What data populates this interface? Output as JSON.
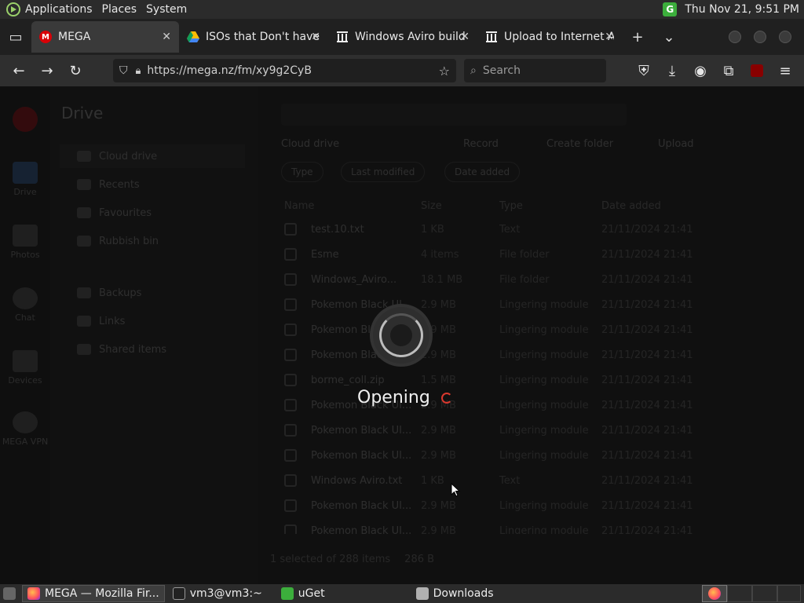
{
  "top_panel": {
    "menus": [
      "Applications",
      "Places",
      "System"
    ],
    "clock": "Thu Nov 21,  9:51 PM"
  },
  "tabs": [
    {
      "title": "MEGA",
      "favicon": "mega-icon",
      "active": true
    },
    {
      "title": "ISOs that Don't haven",
      "favicon": "drive-icon",
      "active": false
    },
    {
      "title": "Windows Aviro build",
      "favicon": "archive-icon",
      "active": false
    },
    {
      "title": "Upload to Internet Arc",
      "favicon": "archive-icon",
      "active": false
    }
  ],
  "navbar": {
    "url": "https://mega.nz/fm/xy9g2CyB",
    "search_placeholder": "Search"
  },
  "mega": {
    "sidebar_title": "Drive",
    "leftnav": [
      "Drive",
      "Photos",
      "Chat",
      "Devices",
      "MEGA VPN"
    ],
    "sidebar_items": [
      "Cloud drive",
      "Recents",
      "Favourites",
      "Rubbish bin"
    ],
    "sidebar_items2": [
      "Backups",
      "Links",
      "Shared items"
    ],
    "breadcrumb": "Cloud drive",
    "toolbar": [
      "Record",
      "Create folder",
      "Upload"
    ],
    "filters": [
      "Type",
      "Last modified",
      "Date added"
    ],
    "columns": [
      "Name",
      "Size",
      "Type",
      "Date added"
    ],
    "files": [
      {
        "name": "test.10.txt",
        "size": "1 KB",
        "type": "Text",
        "date": "21/11/2024 21:41"
      },
      {
        "name": "Esme",
        "size": "4 items",
        "type": "File folder",
        "date": "21/11/2024 21:41"
      },
      {
        "name": "Windows_Aviro...",
        "size": "18.1 MB",
        "type": "File folder",
        "date": "21/11/2024 21:41"
      },
      {
        "name": "Pokemon Black Ul...",
        "size": "2.9 MB",
        "type": "Lingering module",
        "date": "21/11/2024 21:41"
      },
      {
        "name": "Pokemon Black Ul...",
        "size": "2.9 MB",
        "type": "Lingering module",
        "date": "21/11/2024 21:41"
      },
      {
        "name": "Pokemon Black Ul...",
        "size": "2.9 MB",
        "type": "Lingering module",
        "date": "21/11/2024 21:41"
      },
      {
        "name": "borme_coll.zip",
        "size": "1.5 MB",
        "type": "Lingering module",
        "date": "21/11/2024 21:41"
      },
      {
        "name": "Pokemon Black Ul...",
        "size": "2.9 MB",
        "type": "Lingering module",
        "date": "21/11/2024 21:41"
      },
      {
        "name": "Pokemon Black Ul...",
        "size": "2.9 MB",
        "type": "Lingering module",
        "date": "21/11/2024 21:41"
      },
      {
        "name": "Pokemon Black Ul...",
        "size": "2.9 MB",
        "type": "Lingering module",
        "date": "21/11/2024 21:41"
      },
      {
        "name": "Windows Aviro.txt",
        "size": "1 KB",
        "type": "Text",
        "date": "21/11/2024 21:41"
      },
      {
        "name": "Pokemon Black Ul...",
        "size": "2.9 MB",
        "type": "Lingering module",
        "date": "21/11/2024 21:41"
      },
      {
        "name": "Pokemon Black Ul...",
        "size": "2.9 MB",
        "type": "Lingering module",
        "date": "21/11/2024 21:41"
      }
    ],
    "status": "1 selected of 288 items",
    "status_size": "286 B"
  },
  "overlay": {
    "opening_text": "Opening"
  },
  "taskbar": [
    {
      "label": "MEGA — Mozilla Fir...",
      "icon": "firefox-icon",
      "active": true
    },
    {
      "label": "vm3@vm3:~",
      "icon": "terminal-icon",
      "active": false
    },
    {
      "label": "uGet",
      "icon": "uget-icon",
      "active": false
    },
    {
      "label": "Downloads",
      "icon": "folder-icon",
      "active": false
    }
  ],
  "colors": {
    "accent": "#d9382e",
    "mega_red": "#d90007"
  }
}
